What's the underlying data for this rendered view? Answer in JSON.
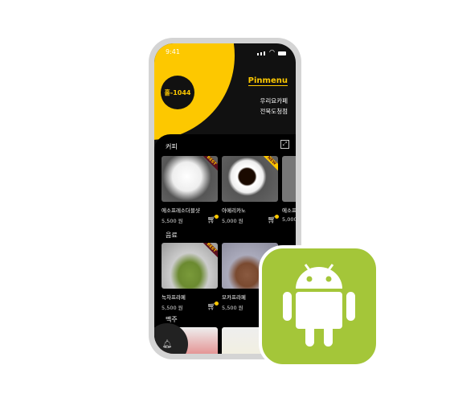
{
  "status": {
    "time": "9:41"
  },
  "header": {
    "badge": "홀-1044",
    "logo": "Pinmenu",
    "store_line1": "우리요카페",
    "store_line2": "전북도청점"
  },
  "categories": [
    {
      "name": "커피",
      "items": [
        {
          "name": "에소프레소더블샷",
          "price": "5,500 원",
          "ribbon": "BEST"
        },
        {
          "name": "아메리카노",
          "price": "5,000 원",
          "ribbon": "NEW"
        },
        {
          "name": "에소프",
          "price": "5,000"
        }
      ]
    },
    {
      "name": "음료",
      "items": [
        {
          "name": "녹차프라페",
          "price": "5,500 원",
          "ribbon": "BEST"
        },
        {
          "name": "모카프라페",
          "price": "5,500 원"
        }
      ]
    },
    {
      "name": "맥주"
    }
  ],
  "colors": {
    "accent": "#fdc800",
    "android": "#a4c639"
  }
}
